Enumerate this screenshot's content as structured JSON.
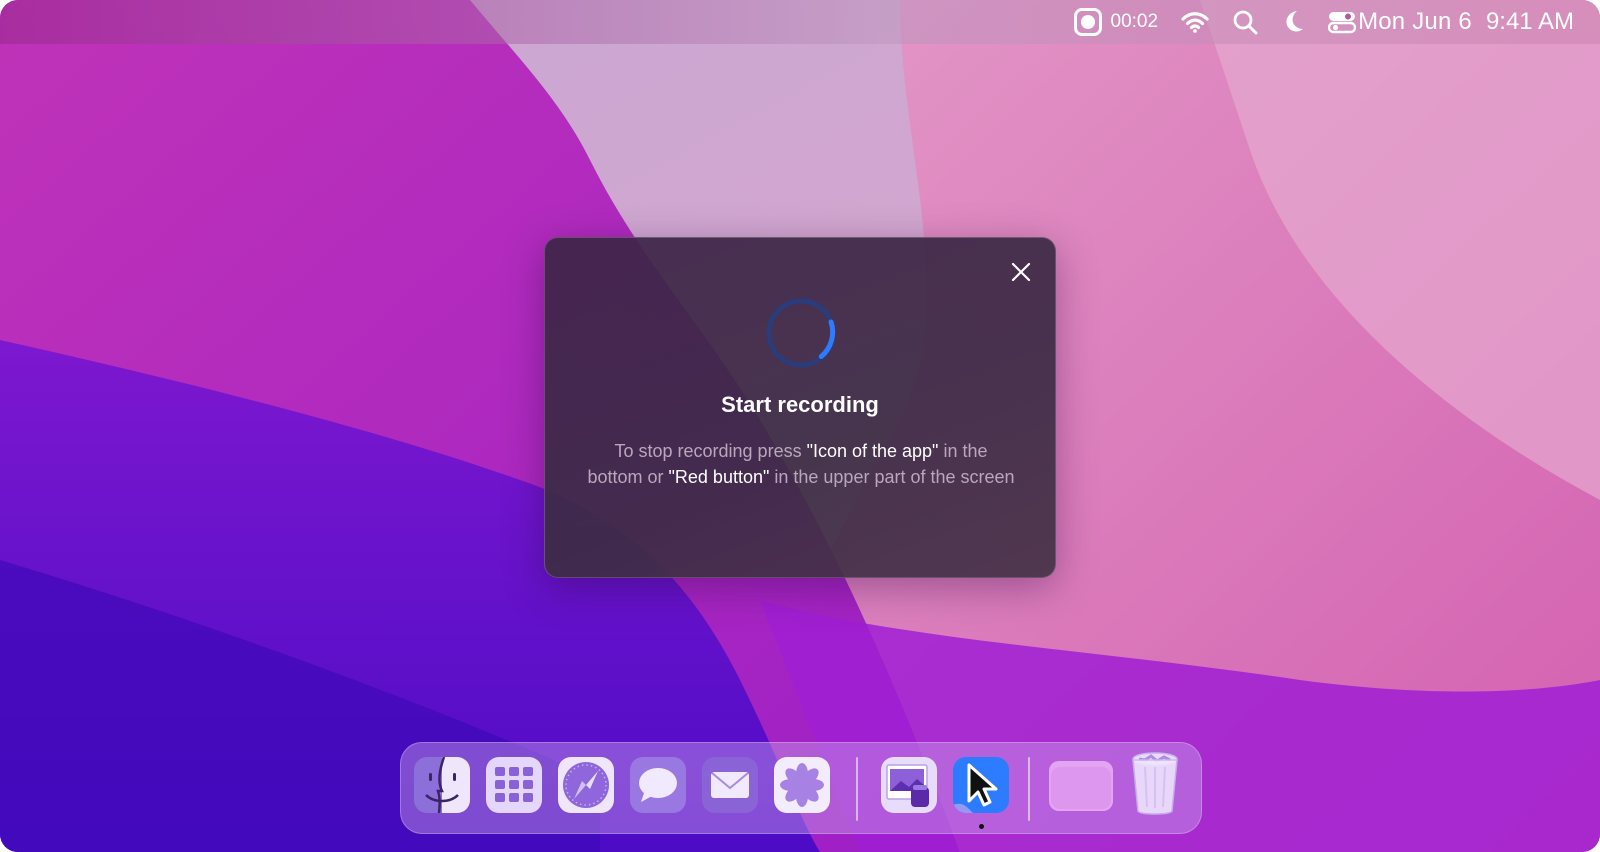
{
  "menubar": {
    "recording_time": "00:02",
    "date": "Mon Jun 6",
    "time": "9:41 AM",
    "icons": [
      "screen-record-icon",
      "wifi-icon",
      "search-icon",
      "moon-icon",
      "control-center-icon"
    ]
  },
  "dialog": {
    "title": "Start recording",
    "body_part1": "To stop recording press ",
    "highlight1": "\"Icon of the app\"",
    "body_part2": " in the bottom or ",
    "highlight2": "\"Red button\"",
    "body_part3": " in the upper part of the screen",
    "icons": [
      "close-icon",
      "loading-spinner-icon"
    ]
  },
  "dock": {
    "apps": [
      {
        "name": "Finder",
        "icon": "finder-icon"
      },
      {
        "name": "Launchpad",
        "icon": "launchpad-icon"
      },
      {
        "name": "Safari",
        "icon": "safari-icon"
      },
      {
        "name": "Messages",
        "icon": "messages-icon"
      },
      {
        "name": "Mail",
        "icon": "mail-icon"
      },
      {
        "name": "Photos",
        "icon": "photos-icon"
      },
      {
        "name": "Preview",
        "icon": "preview-icon"
      },
      {
        "name": "Screen Recorder",
        "icon": "cursor-app-icon",
        "running": true
      },
      {
        "name": "Folder",
        "icon": "folder-icon"
      },
      {
        "name": "Trash",
        "icon": "trash-icon"
      }
    ]
  },
  "colors": {
    "accent_blue": "#2d7bff",
    "dialog_bg": "#3e2c48",
    "body_text": "#b9a7bd"
  }
}
